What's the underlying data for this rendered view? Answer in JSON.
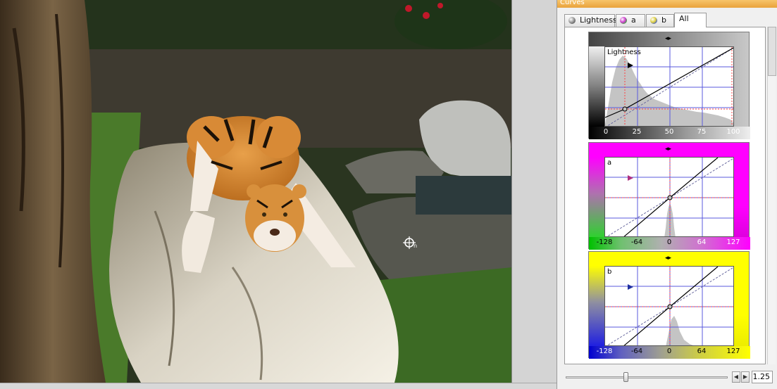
{
  "panel": {
    "title": "Curves",
    "tabs": [
      {
        "label": "Lightness",
        "icon": "lightness-ball-icon",
        "color": "#808080"
      },
      {
        "label": "a",
        "icon": "a-channel-ball-icon",
        "color": "#30b030"
      },
      {
        "label": "b",
        "icon": "b-channel-ball-icon",
        "color": "#3050d0"
      },
      {
        "label": "All",
        "active": true
      }
    ]
  },
  "curves": {
    "lightness": {
      "label": "Lightness",
      "ticks": [
        "0",
        "25",
        "50",
        "75",
        "100"
      ],
      "color": "#808080"
    },
    "a": {
      "label": "a",
      "ticks": [
        "-128",
        "-64",
        "0",
        "64",
        "127"
      ],
      "color": "#ff00ff"
    },
    "b": {
      "label": "b",
      "ticks": [
        "-128",
        "-64",
        "0",
        "64",
        "127"
      ],
      "color": "#ffff00"
    }
  },
  "slider": {
    "value": "1.25",
    "position_fraction": 0.37,
    "prev_icon": "chevron-left-icon",
    "next_icon": "chevron-right-icon"
  },
  "cursor": {
    "icon": "crosshair-cursor-icon",
    "suffix": "n"
  }
}
